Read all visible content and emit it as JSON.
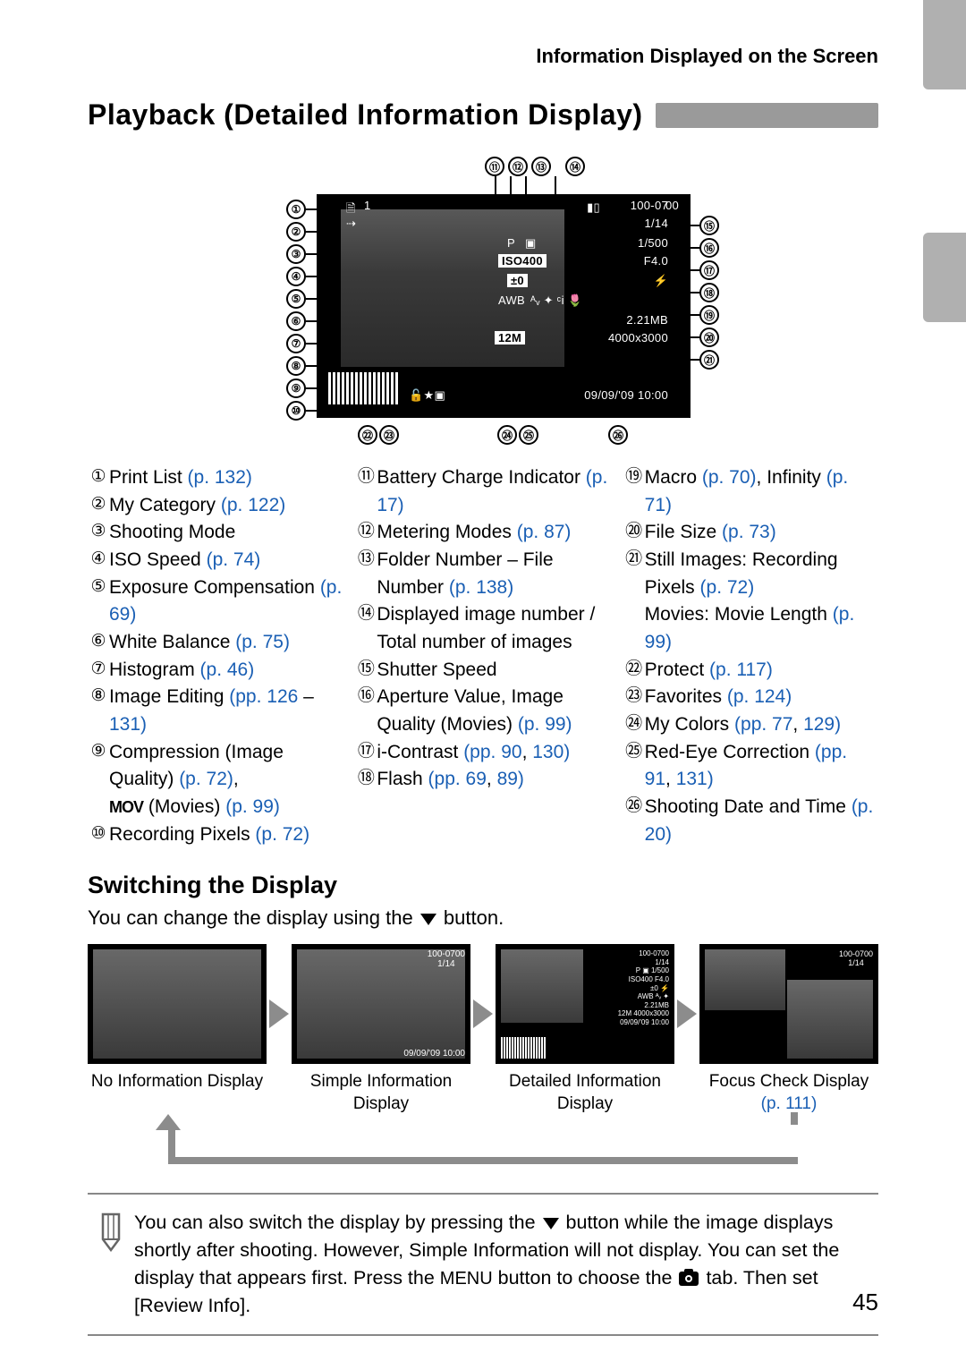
{
  "header": "Information Displayed on the Screen",
  "title": "Playback (Detailed Information Display)",
  "figure": {
    "top_numbers": [
      "⑪",
      "⑫",
      "⑬",
      "⑭"
    ],
    "left_numbers": [
      "①",
      "②",
      "③",
      "④",
      "⑤",
      "⑥",
      "⑦",
      "⑧",
      "⑨",
      "⑩"
    ],
    "right_numbers": [
      "⑮",
      "⑯",
      "⑰",
      "⑱",
      "⑲",
      "⑳",
      "㉑"
    ],
    "bottom_numbers": [
      "㉒",
      "㉓",
      "㉔",
      "㉕",
      "㉖"
    ],
    "screen": {
      "folder_file": "100-07",
      "img_idx": "1/14",
      "one": "1",
      "shutter": "1/500",
      "p": "P",
      "iso": "ISO400",
      "aperture": "F4.0",
      "ev": "±0",
      "awb": "AWB",
      "filesize": "2.21MB",
      "pixels": "4000x3000",
      "size_label": "12M",
      "datetime": "09/09/'09   10:00"
    }
  },
  "legend": {
    "col1": [
      {
        "n": "①",
        "pre": "Print List ",
        "links": [
          {
            "t": "(p. 132)",
            "href": "#"
          }
        ]
      },
      {
        "n": "②",
        "pre": "My Category ",
        "links": [
          {
            "t": "(p. 122)",
            "href": "#"
          }
        ]
      },
      {
        "n": "③",
        "pre": "Shooting Mode",
        "links": []
      },
      {
        "n": "④",
        "pre": "ISO Speed ",
        "links": [
          {
            "t": "(p. 74)",
            "href": "#"
          }
        ]
      },
      {
        "n": "⑤",
        "pre": "Exposure Compensation ",
        "links": [
          {
            "t": "(p. 69)",
            "href": "#"
          }
        ]
      },
      {
        "n": "⑥",
        "pre": "White Balance ",
        "links": [
          {
            "t": "(p. 75)",
            "href": "#"
          }
        ]
      },
      {
        "n": "⑦",
        "pre": "Histogram ",
        "links": [
          {
            "t": "(p. 46)",
            "href": "#"
          }
        ]
      },
      {
        "n": "⑧",
        "pre": "Image Editing ",
        "links": [
          {
            "t": "(pp. 126",
            "href": "#"
          },
          {
            "t": " – ",
            "plain": true
          },
          {
            "t": "131)",
            "href": "#"
          }
        ]
      },
      {
        "n": "⑨",
        "pre": "Compression (Image Quality) ",
        "links": [
          {
            "t": "(p. 72)",
            "href": "#"
          },
          {
            "t": ", ",
            "plain": true
          }
        ],
        "suffix_mov": true,
        "suffix_text": " (Movies) ",
        "suffix_links": [
          {
            "t": "(p. 99)",
            "href": "#"
          }
        ]
      },
      {
        "n": "⑩",
        "pre": "Recording Pixels ",
        "links": [
          {
            "t": "(p. 72)",
            "href": "#"
          }
        ]
      }
    ],
    "col2": [
      {
        "n": "⑪",
        "pre": "Battery Charge Indicator ",
        "links": [
          {
            "t": "(p. 17)",
            "href": "#"
          }
        ]
      },
      {
        "n": "⑫",
        "pre": "Metering Modes ",
        "links": [
          {
            "t": "(p. 87)",
            "href": "#"
          }
        ]
      },
      {
        "n": "⑬",
        "pre": "Folder Number – File Number ",
        "links": [
          {
            "t": "(p. 138)",
            "href": "#"
          }
        ]
      },
      {
        "n": "⑭",
        "pre": "Displayed image number / Total number of images",
        "links": []
      },
      {
        "n": "⑮",
        "pre": "Shutter Speed",
        "links": []
      },
      {
        "n": "⑯",
        "pre": "Aperture Value, Image Quality (Movies) ",
        "links": [
          {
            "t": "(p. 99)",
            "href": "#"
          }
        ]
      },
      {
        "n": "⑰",
        "pre": "i-Contrast ",
        "links": [
          {
            "t": "(pp. 90",
            "href": "#"
          },
          {
            "t": ", ",
            "plain": true
          },
          {
            "t": "130)",
            "href": "#"
          }
        ]
      },
      {
        "n": "⑱",
        "pre": "Flash ",
        "links": [
          {
            "t": "(pp. 69",
            "href": "#"
          },
          {
            "t": ", ",
            "plain": true
          },
          {
            "t": "89)",
            "href": "#"
          }
        ]
      }
    ],
    "col3": [
      {
        "n": "⑲",
        "pre": "Macro ",
        "links": [
          {
            "t": "(p. 70)",
            "href": "#"
          },
          {
            "t": ", Infinity ",
            "plain": true
          },
          {
            "t": "(p. 71)",
            "href": "#"
          }
        ]
      },
      {
        "n": "⑳",
        "pre": "File Size ",
        "links": [
          {
            "t": "(p. 73)",
            "href": "#"
          }
        ]
      },
      {
        "n": "㉑",
        "pre": "Still Images: Recording Pixels ",
        "links": [
          {
            "t": "(p. 72)",
            "href": "#"
          }
        ],
        "br": true,
        "pre2": "Movies: Movie Length ",
        "links2": [
          {
            "t": "(p. 99)",
            "href": "#"
          }
        ]
      },
      {
        "n": "㉒",
        "pre": "Protect ",
        "links": [
          {
            "t": "(p. 117)",
            "href": "#"
          }
        ]
      },
      {
        "n": "㉓",
        "pre": "Favorites ",
        "links": [
          {
            "t": "(p. 124)",
            "href": "#"
          }
        ]
      },
      {
        "n": "㉔",
        "pre": "My Colors ",
        "links": [
          {
            "t": "(pp. 77",
            "href": "#"
          },
          {
            "t": ", ",
            "plain": true
          },
          {
            "t": "129)",
            "href": "#"
          }
        ]
      },
      {
        "n": "㉕",
        "pre": "Red-Eye Correction ",
        "links": [
          {
            "t": "(pp. 91",
            "href": "#"
          },
          {
            "t": ", ",
            "plain": true
          },
          {
            "t": "131)",
            "href": "#"
          }
        ]
      },
      {
        "n": "㉖",
        "pre": "Shooting Date and Time ",
        "links": [
          {
            "t": "(p. 20)",
            "href": "#"
          }
        ]
      }
    ]
  },
  "h2": "Switching the Display",
  "switch_intro_pre": "You can change the display using the ",
  "switch_intro_post": " button.",
  "modes": [
    {
      "label": "No Information Display",
      "link": null
    },
    {
      "label": "Simple Information Display",
      "link": null
    },
    {
      "label": "Detailed Information Display",
      "link": null
    },
    {
      "label": "Focus Check Display",
      "link": "(p. 111)"
    }
  ],
  "note": {
    "t1": "You can also switch the display by pressing the ",
    "t2": " button while the image displays shortly after shooting. However, Simple Information will not display. You can set the display that appears first. Press the ",
    "menu": "MENU",
    "t3": " button to choose the ",
    "t4": " tab. Then set [Review Info]."
  },
  "page_number": "45"
}
